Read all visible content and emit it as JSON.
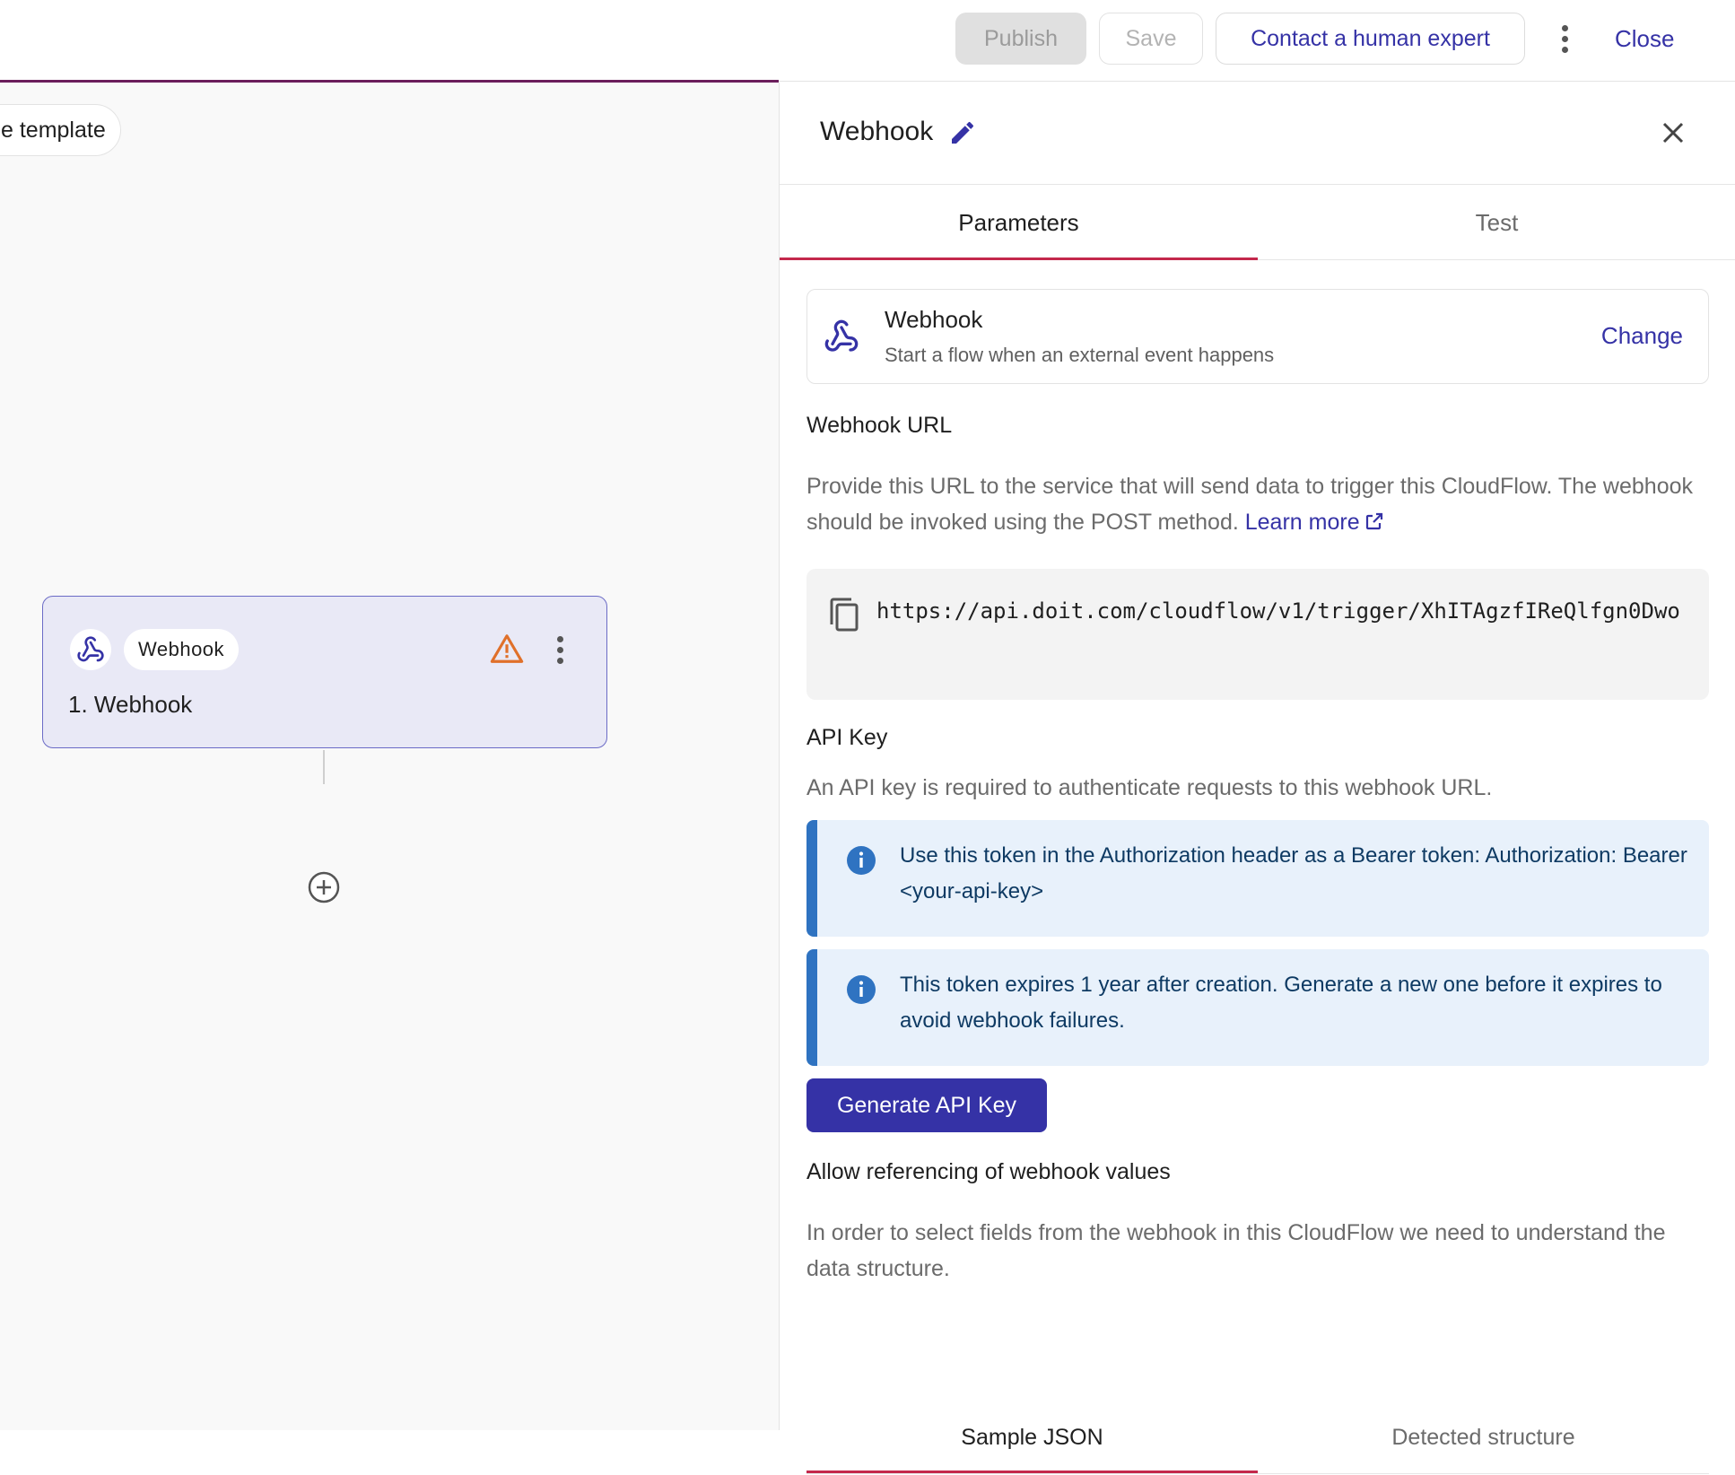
{
  "topbar": {
    "publish_label": "Publish",
    "save_label": "Save",
    "contact_label": "Contact a human expert",
    "close_label": "Close",
    "more_icon": "more-vertical-icon"
  },
  "canvas": {
    "template_pill_label": "e template",
    "node": {
      "badge_label": "Webhook",
      "title": "1. Webhook",
      "icon": "webhook-icon",
      "status_icon": "warning-icon"
    },
    "add_icon": "add-circle-icon"
  },
  "panel": {
    "title": "Webhook",
    "tabs": [
      {
        "label": "Parameters",
        "active": true
      },
      {
        "label": "Test",
        "active": false
      }
    ],
    "trigger": {
      "name": "Webhook",
      "description": "Start a flow when an external event happens",
      "change_label": "Change"
    },
    "webhook_url": {
      "title": "Webhook URL",
      "description": "Provide this URL to the service that will send data to trigger this CloudFlow. The webhook should be invoked using the POST method.",
      "learn_more_label": "Learn more",
      "url": "https://api.doit.com/cloudflow/v1/trigger/XhITAgzfIReQlfgn0Dwo"
    },
    "api_key": {
      "title": "API Key",
      "description": "An API key is required to authenticate requests to this webhook URL.",
      "alerts": [
        "Use this token in the Authorization header as a Bearer token: Authorization: Bearer <your-api-key>",
        "This token expires 1 year after creation. Generate a new one before it expires to avoid webhook failures."
      ],
      "generate_label": "Generate API Key"
    },
    "referencing": {
      "title": "Allow referencing of webhook values",
      "description": "In order to select fields from the webhook in this CloudFlow we need to understand the data structure.",
      "tabs": [
        {
          "label": "Sample JSON",
          "active": true
        },
        {
          "label": "Detected structure",
          "active": false
        }
      ]
    }
  },
  "colors": {
    "accent": "#3532a6",
    "tab_indicator": "#c4284c",
    "info_bar": "#2f73c1",
    "warning": "#e0702a"
  }
}
